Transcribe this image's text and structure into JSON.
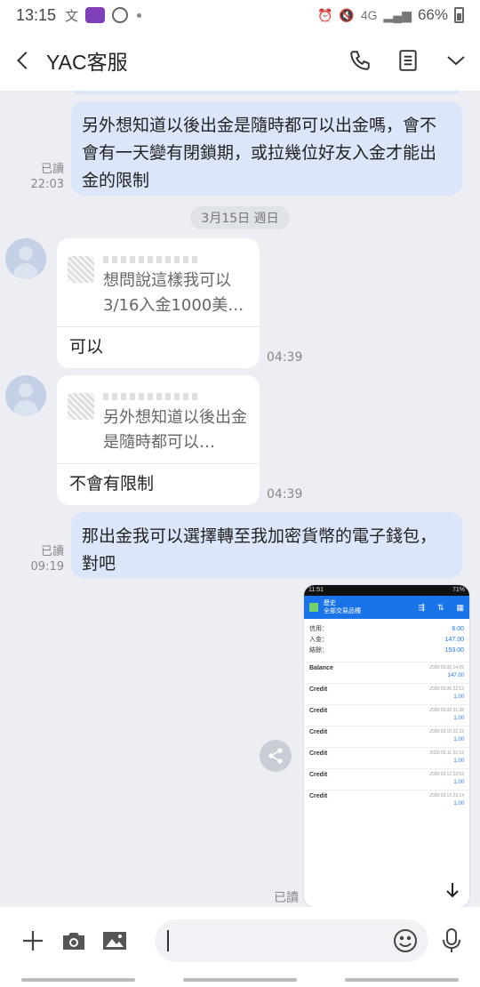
{
  "status_bar": {
    "time": "13:15",
    "icon_a": "文",
    "battery": "66%",
    "signal": "4G"
  },
  "header": {
    "title": "YAC客服"
  },
  "messages": {
    "m1_text": "另外想知道以後出金是隨時都可以出金嗎，會不會有一天變有閉鎖期，或拉幾位好友入金才能出金的限制",
    "m1_read": "已讀",
    "m1_time": "22:03",
    "date_divider": "3月15日 週日",
    "r1_quote": "想問說這樣我可以3/16入金1000美…",
    "r1_reply": "可以",
    "r1_time": "04:39",
    "r2_quote": "另外想知道以後出金是隨時都可以…",
    "r2_reply": "不會有限制",
    "r2_time": "04:39",
    "m2_text": "那出金我可以選擇轉至我加密貨幣的電子錢包，對吧",
    "m2_read": "已讀",
    "m2_time": "09:19",
    "m3_read": "已讀"
  },
  "image_message": {
    "status_time": "11:51",
    "status_right": "71%",
    "bar_line1": "歷史",
    "bar_line2": "全部交易品種",
    "summary": [
      {
        "label": "信用：",
        "value": "6.00"
      },
      {
        "label": "入金：",
        "value": "147.00"
      },
      {
        "label": "結餘：",
        "value": "153.00"
      }
    ],
    "entries": [
      {
        "type": "Balance",
        "date": "2020.03.05 14:05",
        "amount": "147.00"
      },
      {
        "type": "Credit",
        "date": "2020.03.06 22:13",
        "amount": "1.00"
      },
      {
        "type": "Credit",
        "date": "2020.03.09 21:38",
        "amount": "1.00"
      },
      {
        "type": "Credit",
        "date": "2020.03.10 22:22",
        "amount": "1.00"
      },
      {
        "type": "Credit",
        "date": "2020.03.11 21:52",
        "amount": "1.00"
      },
      {
        "type": "Credit",
        "date": "2020.03.12 22:03",
        "amount": "1.00"
      },
      {
        "type": "Credit",
        "date": "2020.03.13 23:14",
        "amount": "1.00"
      }
    ]
  },
  "colors": {
    "outgoing_bubble": "#dbe6fa",
    "background": "#eceef3",
    "accent": "#1a73e8"
  },
  "icons": [
    "back-chevron-icon",
    "phone-icon",
    "notes-icon",
    "chevron-down-icon",
    "plus-icon",
    "camera-icon",
    "image-icon",
    "emoji-icon",
    "mic-icon",
    "share-icon",
    "arrow-down-icon"
  ]
}
